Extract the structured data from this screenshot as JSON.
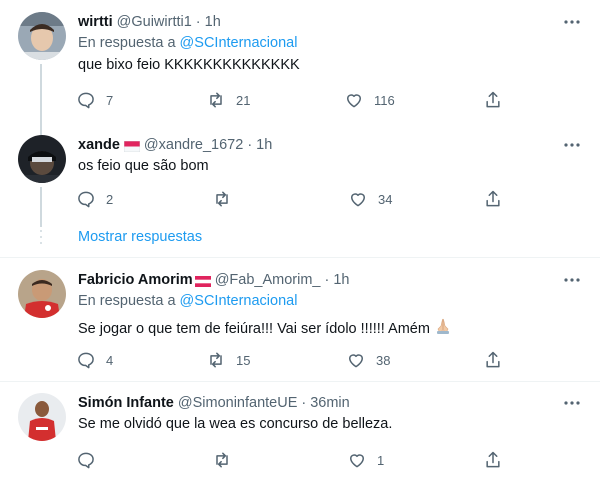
{
  "tweets": [
    {
      "name": "wirtti",
      "handle": "@Guiwirtti1",
      "sep": "·",
      "time": "1h",
      "reply_prefix": "En respuesta a",
      "reply_mention": "@SCInternacional",
      "text": "que bixo feio KKKKKKKKKKKKKK",
      "replies": "7",
      "retweets": "21",
      "likes": "116"
    },
    {
      "name": "xande",
      "handle": "@xandre_1672",
      "sep": "·",
      "time": "1h",
      "text": "os feio que são bom",
      "replies": "2",
      "retweets": "",
      "likes": "34"
    },
    {
      "name": "Fabricio Amorim",
      "handle": "@Fab_Amorim_",
      "sep": "·",
      "time": "1h",
      "reply_prefix": "En respuesta a",
      "reply_mention": "@SCInternacional",
      "text": "Se jogar o que tem de feiúra!!! Vai ser ídolo !!!!!! Amém",
      "replies": "4",
      "retweets": "15",
      "likes": "38"
    },
    {
      "name": "Simón Infante",
      "handle": "@SimoninfanteUE",
      "sep": "·",
      "time": "36min",
      "text": "Se me olvidó que la wea es concurso de belleza.",
      "replies": "",
      "retweets": "",
      "likes": "1"
    }
  ],
  "show_more": "Mostrar respuestas",
  "colors": {
    "accent": "#1d9bf0",
    "secondary_text": "#536471",
    "line": "#cfd9de"
  },
  "icons": [
    "reply-icon",
    "retweet-icon",
    "like-icon",
    "share-icon",
    "more-icon",
    "flag-icon",
    "praying-hands-emoji"
  ]
}
